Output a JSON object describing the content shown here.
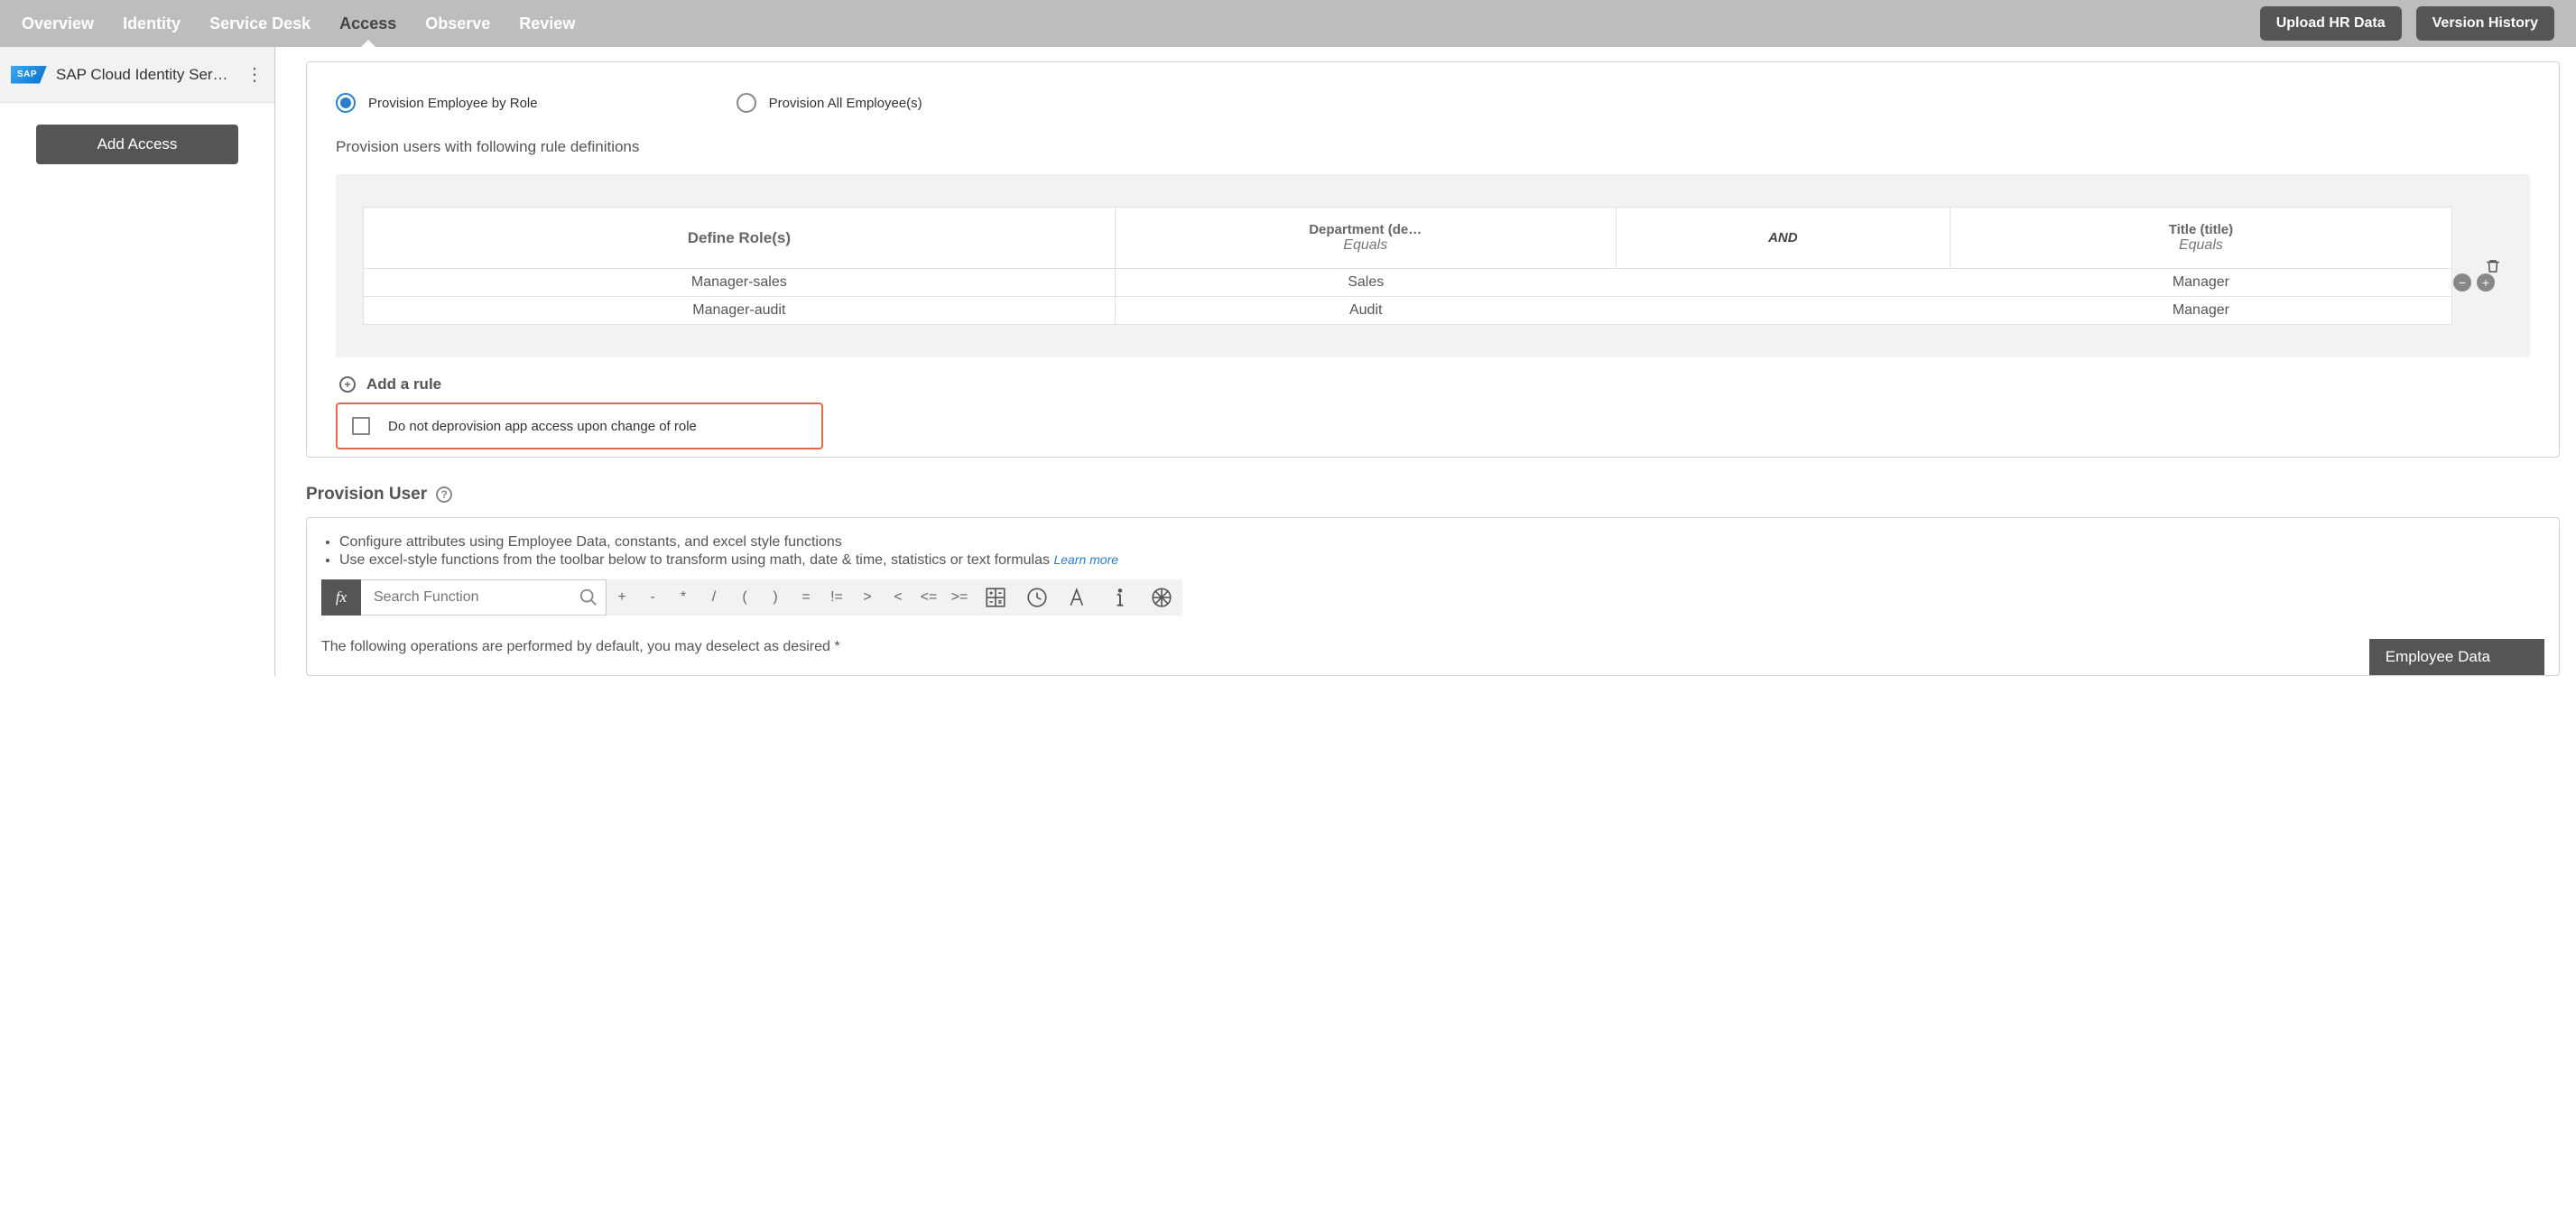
{
  "nav": {
    "tabs": {
      "overview": "Overview",
      "identity": "Identity",
      "service_desk": "Service Desk",
      "access": "Access",
      "observe": "Observe",
      "review": "Review"
    },
    "upload_btn": "Upload HR Data",
    "version_btn": "Version History"
  },
  "sidebar": {
    "app_name": "SAP Cloud Identity Ser…",
    "logo_text": "SAP",
    "add_access": "Add Access"
  },
  "panel": {
    "radio_by_role": "Provision Employee by Role",
    "radio_all": "Provision All Employee(s)",
    "desc": "Provision users with following rule definitions",
    "header": {
      "role": "Define Role(s)",
      "dept": "Department (de…",
      "dept_sub": "Equals",
      "and": "AND",
      "title": "Title (title)",
      "title_sub": "Equals"
    },
    "rows": [
      {
        "role": "Manager-sales",
        "dept": "Sales",
        "title": "Manager"
      },
      {
        "role": "Manager-audit",
        "dept": "Audit",
        "title": "Manager"
      }
    ],
    "add_rule": "Add a rule",
    "no_deprov": "Do not deprovision app access upon change of role"
  },
  "provision_user": {
    "heading": "Provision User",
    "bullet1": "Configure attributes using Employee Data, constants, and excel style functions",
    "bullet2": "Use excel-style functions from the toolbar below to transform using math, date & time, statistics or text formulas",
    "learn_more": "Learn more",
    "fx": "fx",
    "search_ph": "Search Function",
    "ops": [
      "+",
      "-",
      "*",
      "/",
      "(",
      ")",
      "=",
      "!=",
      ">",
      "<",
      "<=",
      ">="
    ],
    "default_text": "The following operations are performed by default, you may deselect as desired *",
    "emp_data": "Employee Data"
  }
}
